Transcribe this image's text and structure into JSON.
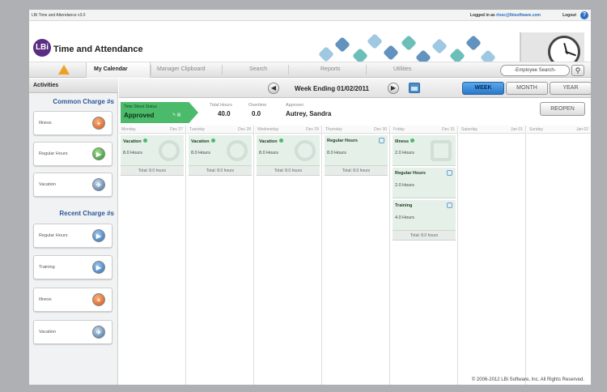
{
  "topbar": {
    "app_title": "LBi Time and Attendance v3.0",
    "login_prefix": "Logged in as ",
    "login_email": "rlosc@lbisoftware.com",
    "logout": "Logout",
    "help": "?"
  },
  "header": {
    "logo": "LBi",
    "title": "Time and Attendance"
  },
  "nav": {
    "tabs": [
      {
        "label": "My Calendar",
        "active": true
      },
      {
        "label": "Manager Clipboard",
        "active": false
      },
      {
        "label": "Search",
        "active": false
      },
      {
        "label": "Reports",
        "active": false
      },
      {
        "label": "Utilities",
        "active": false
      }
    ],
    "employee_search": "-Employee Search-"
  },
  "sidebar": {
    "title": "Activities",
    "common_title": "Common Charge #s",
    "common": [
      {
        "label": "Illness",
        "icon": "add-icon",
        "color": "orange"
      },
      {
        "label": "Regular Hours",
        "icon": "play-icon",
        "color": "green"
      },
      {
        "label": "Vacation",
        "icon": "travel-icon",
        "color": "gray"
      }
    ],
    "recent_title": "Recent Charge #s",
    "recent": [
      {
        "label": "Regular Hours",
        "icon": "play-icon",
        "color": "blue"
      },
      {
        "label": "Training",
        "icon": "play-icon",
        "color": "blue"
      },
      {
        "label": "Illness",
        "icon": "add-icon",
        "color": "orange"
      },
      {
        "label": "Vacation",
        "icon": "travel-icon",
        "color": "gray"
      }
    ]
  },
  "week": {
    "label": "Week Ending 01/02/2011",
    "views": [
      "WEEK",
      "MONTH",
      "YEAR"
    ],
    "active_view": "WEEK"
  },
  "status": {
    "label": "Time Sheet Status",
    "value": "Approved",
    "total_label": "Total Hours",
    "total_value": "40.0",
    "overtime_label": "Overtime",
    "overtime_value": "0.0",
    "approver_label": "Approver",
    "approver_value": "Autrey, Sandra",
    "reopen": "REOPEN"
  },
  "days": [
    {
      "name": "Monday",
      "date": "Dec 27",
      "entries": [
        {
          "label": "Vacation",
          "hours": "8.0 Hours",
          "kind": "vacation"
        }
      ],
      "total": "Total: 8.0 hours"
    },
    {
      "name": "Tuesday",
      "date": "Dec 28",
      "entries": [
        {
          "label": "Vacation",
          "hours": "8.0 Hours",
          "kind": "vacation"
        }
      ],
      "total": "Total: 8.0 hours"
    },
    {
      "name": "Wednesday",
      "date": "Dec 29",
      "entries": [
        {
          "label": "Vacation",
          "hours": "8.0 Hours",
          "kind": "vacation"
        }
      ],
      "total": "Total: 8.0 hours"
    },
    {
      "name": "Thursday",
      "date": "Dec 30",
      "entries": [
        {
          "label": "Regular Hours",
          "hours": "8.0 Hours",
          "kind": "regular"
        }
      ],
      "total": "Total: 8.0 hours"
    },
    {
      "name": "Friday",
      "date": "Dec 31",
      "entries": [
        {
          "label": "Illness",
          "hours": "2.0 Hours",
          "kind": "illness"
        },
        {
          "label": "Regular Hours",
          "hours": "2.0 Hours",
          "kind": "regular"
        },
        {
          "label": "Training",
          "hours": "4.0 Hours",
          "kind": "training"
        }
      ],
      "total": "Total: 8.0 hours"
    },
    {
      "name": "Saturday",
      "date": "Jan 01",
      "entries": [],
      "total": ""
    },
    {
      "name": "Sunday",
      "date": "Jan 02",
      "entries": [],
      "total": ""
    }
  ],
  "footer": "© 2006-2012 LBi Software, Inc. All Rights Reserved."
}
